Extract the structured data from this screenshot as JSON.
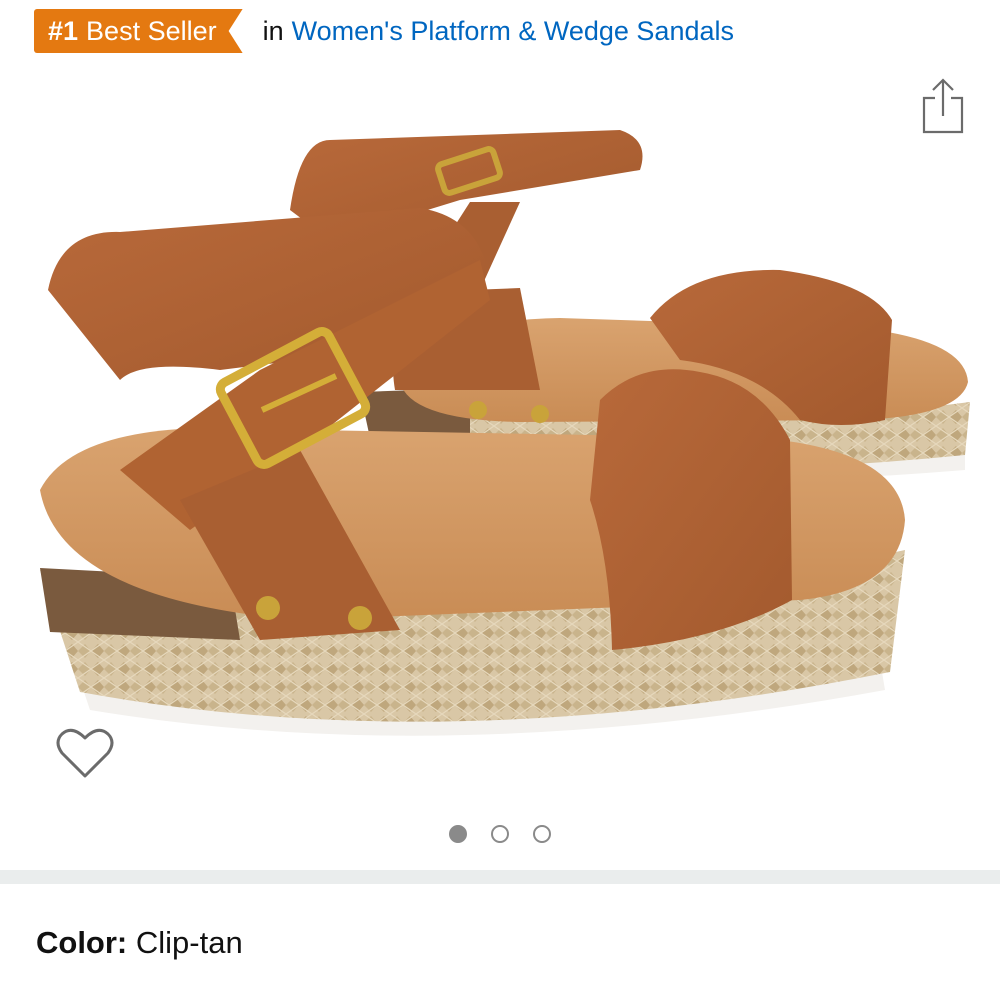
{
  "bestseller": {
    "badge_rank": "#1",
    "badge_text": "Best Seller",
    "in_text": "in",
    "category_link": "Women's Platform & Wedge Sandals",
    "badge_color": "#e47911",
    "link_color": "#0066c0"
  },
  "icons": {
    "share": "share-icon",
    "wishlist": "heart-outline-icon"
  },
  "carousel": {
    "total_images": 3,
    "active_index": 0
  },
  "variation": {
    "color_label": "Color:",
    "color_value": "Clip-tan"
  }
}
